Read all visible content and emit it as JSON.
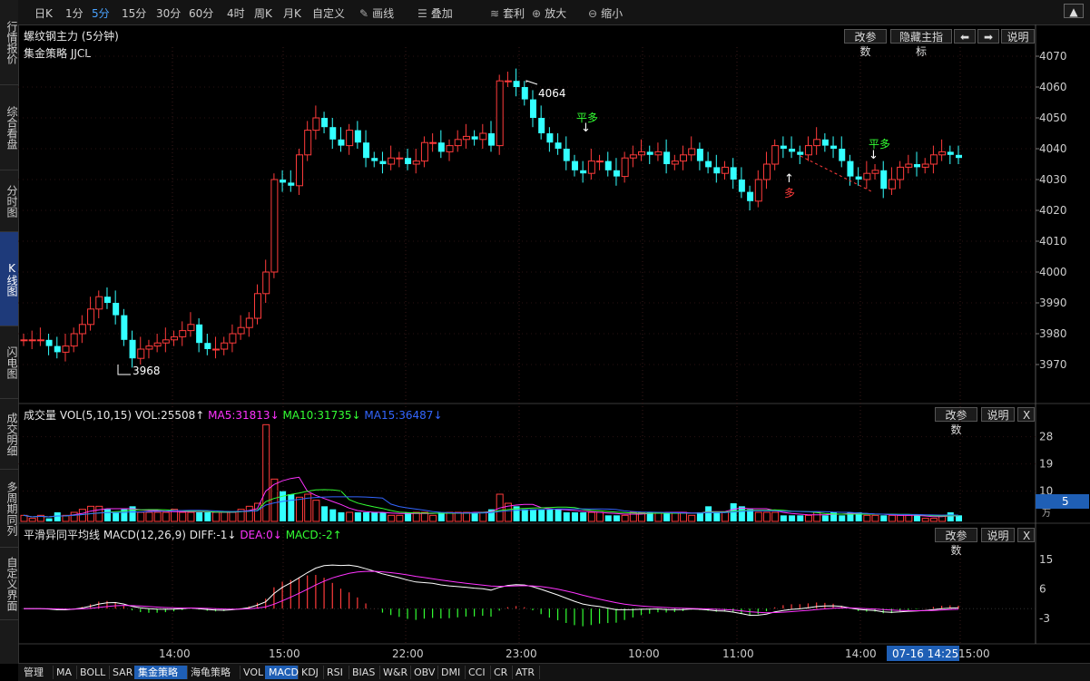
{
  "left_nav": [
    "行情报价",
    "综合看盘",
    "分时图",
    "K线图",
    "闪电图",
    "成交明细",
    "多周期同列",
    "自定义界面"
  ],
  "toolbar": {
    "periods": [
      "日K",
      "1分",
      "5分",
      "15分",
      "30分",
      "60分",
      "4时",
      "周K",
      "月K",
      "自定义"
    ],
    "active_period": "5分",
    "draw": "画线",
    "overlay": "叠加",
    "arbitrage": "套利",
    "zoom_in": "放大",
    "zoom_out": "缩小"
  },
  "main": {
    "title": "螺纹钢主力 (5分钟)",
    "strategy": "集金策略 JJCL",
    "buttons": {
      "params": "改参数",
      "hide": "隐藏主指标",
      "left": "◀",
      "right": "▶",
      "help": "说明"
    },
    "price_ticks": [
      "4070",
      "4060",
      "4050",
      "4040",
      "4030",
      "4020",
      "4010",
      "4000",
      "3990",
      "3980",
      "3970"
    ],
    "high_label": "4064",
    "low_label": "3968",
    "signals": [
      "平多",
      "平多",
      "多"
    ]
  },
  "volume": {
    "title": "成交量 VOL(5,10,15) VOL:25508↑",
    "ma5": "MA5:31813↓",
    "ma10": "MA10:31735↓",
    "ma15": "MA15:36487↓",
    "buttons": {
      "params": "改参数",
      "help": "说明",
      "close": "X"
    },
    "ticks": [
      "28",
      "19",
      "10"
    ],
    "current": "5",
    "unit": "万"
  },
  "macd": {
    "title": "平滑异同平均线 MACD(12,26,9) DIFF:-1↓",
    "dea": "DEA:0↓",
    "macd": "MACD:-2↑",
    "buttons": {
      "params": "改参数",
      "help": "说明",
      "close": "X"
    },
    "ticks": [
      "15",
      "6",
      "-3"
    ]
  },
  "time_axis": {
    "labels": [
      "14:00",
      "15:00",
      "22:00",
      "23:00",
      "10:00",
      "11:00",
      "14:00",
      "15:00"
    ],
    "cursor": "07-16 14:25"
  },
  "bottom_tabs": [
    "管理",
    "MA",
    "BOLL",
    "SAR",
    "集金策略",
    "海龟策略",
    "VOL",
    "MACD",
    "KDJ",
    "RSI",
    "BIAS",
    "W&R",
    "OBV",
    "DMI",
    "CCI",
    "CR",
    "ATR"
  ],
  "active_tabs": [
    "集金策略",
    "MACD"
  ],
  "colors": {
    "up": "#ff3b3b",
    "down": "#33ffff",
    "ma5": "#ff33ff",
    "ma10": "#33ff33",
    "ma15": "#3366ff",
    "grid": "#3a1010",
    "accent": "#1f5fb5"
  }
}
